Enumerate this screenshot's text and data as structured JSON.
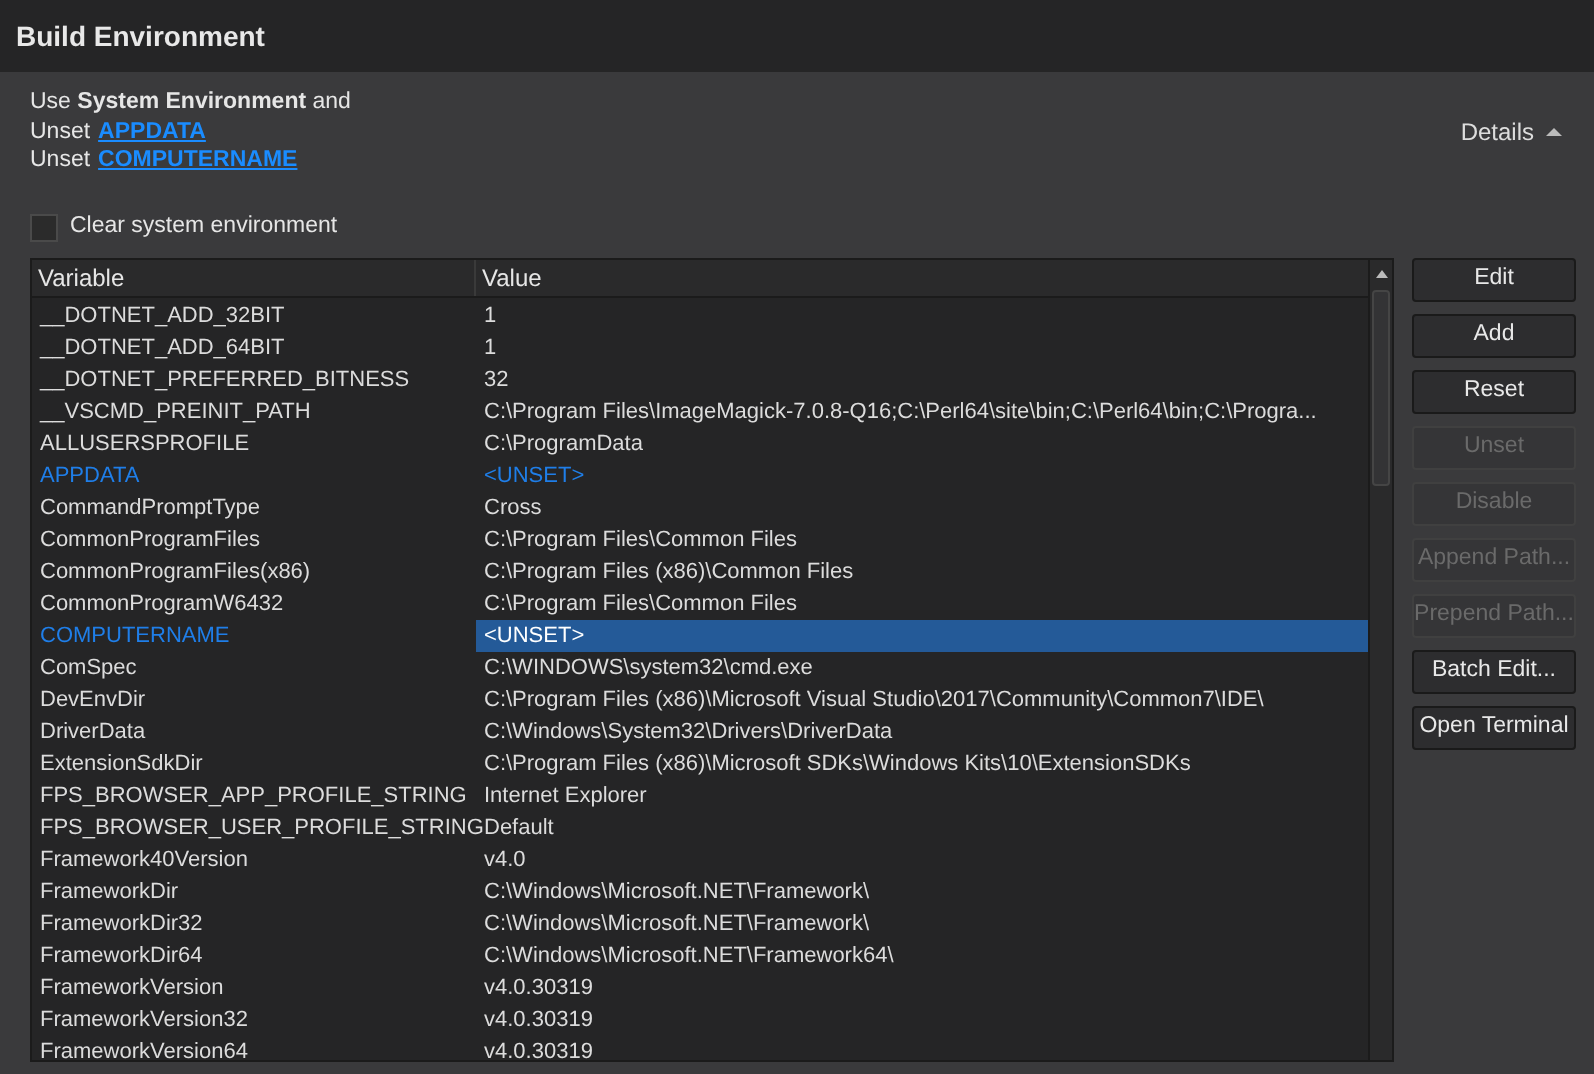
{
  "window": {
    "title": "Build Environment"
  },
  "summary": {
    "intro": "Use **System Environment** and",
    "lines": [
      {
        "prefix": "Unset",
        "link": "APPDATA"
      },
      {
        "prefix": "Unset",
        "link": "COMPUTERNAME"
      }
    ]
  },
  "details": {
    "label": "Details",
    "expanded": true
  },
  "clear_system_environment": {
    "label": "Clear system environment",
    "checked": false
  },
  "table": {
    "columns": [
      "Variable",
      "Value"
    ],
    "rows": [
      {
        "variable": "__DOTNET_ADD_32BIT",
        "value": "1",
        "unset": false,
        "selected": false
      },
      {
        "variable": "__DOTNET_ADD_64BIT",
        "value": "1",
        "unset": false,
        "selected": false
      },
      {
        "variable": "__DOTNET_PREFERRED_BITNESS",
        "value": "32",
        "unset": false,
        "selected": false
      },
      {
        "variable": "__VSCMD_PREINIT_PATH",
        "value": "C:\\Program Files\\ImageMagick-7.0.8-Q16;C:\\Perl64\\site\\bin;C:\\Perl64\\bin;C:\\Progra...",
        "unset": false,
        "selected": false
      },
      {
        "variable": "ALLUSERSPROFILE",
        "value": "C:\\ProgramData",
        "unset": false,
        "selected": false
      },
      {
        "variable": "APPDATA",
        "value": "<UNSET>",
        "unset": true,
        "selected": false
      },
      {
        "variable": "CommandPromptType",
        "value": "Cross",
        "unset": false,
        "selected": false
      },
      {
        "variable": "CommonProgramFiles",
        "value": "C:\\Program Files\\Common Files",
        "unset": false,
        "selected": false
      },
      {
        "variable": "CommonProgramFiles(x86)",
        "value": "C:\\Program Files (x86)\\Common Files",
        "unset": false,
        "selected": false
      },
      {
        "variable": "CommonProgramW6432",
        "value": "C:\\Program Files\\Common Files",
        "unset": false,
        "selected": false
      },
      {
        "variable": "COMPUTERNAME",
        "value": "<UNSET>",
        "unset": true,
        "selected": true
      },
      {
        "variable": "ComSpec",
        "value": "C:\\WINDOWS\\system32\\cmd.exe",
        "unset": false,
        "selected": false
      },
      {
        "variable": "DevEnvDir",
        "value": "C:\\Program Files (x86)\\Microsoft Visual Studio\\2017\\Community\\Common7\\IDE\\",
        "unset": false,
        "selected": false
      },
      {
        "variable": "DriverData",
        "value": "C:\\Windows\\System32\\Drivers\\DriverData",
        "unset": false,
        "selected": false
      },
      {
        "variable": "ExtensionSdkDir",
        "value": "C:\\Program Files (x86)\\Microsoft SDKs\\Windows Kits\\10\\ExtensionSDKs",
        "unset": false,
        "selected": false
      },
      {
        "variable": "FPS_BROWSER_APP_PROFILE_STRING",
        "value": "Internet Explorer",
        "unset": false,
        "selected": false
      },
      {
        "variable": "FPS_BROWSER_USER_PROFILE_STRING",
        "value": "Default",
        "unset": false,
        "selected": false
      },
      {
        "variable": "Framework40Version",
        "value": "v4.0",
        "unset": false,
        "selected": false
      },
      {
        "variable": "FrameworkDir",
        "value": "C:\\Windows\\Microsoft.NET\\Framework\\",
        "unset": false,
        "selected": false
      },
      {
        "variable": "FrameworkDir32",
        "value": "C:\\Windows\\Microsoft.NET\\Framework\\",
        "unset": false,
        "selected": false
      },
      {
        "variable": "FrameworkDir64",
        "value": "C:\\Windows\\Microsoft.NET\\Framework64\\",
        "unset": false,
        "selected": false
      },
      {
        "variable": "FrameworkVersion",
        "value": "v4.0.30319",
        "unset": false,
        "selected": false
      },
      {
        "variable": "FrameworkVersion32",
        "value": "v4.0.30319",
        "unset": false,
        "selected": false
      },
      {
        "variable": "FrameworkVersion64",
        "value": "v4.0.30319",
        "unset": false,
        "selected": false
      }
    ]
  },
  "buttons": [
    {
      "label": "Edit",
      "disabled": false
    },
    {
      "label": "Add",
      "disabled": false
    },
    {
      "label": "Reset",
      "disabled": false
    },
    {
      "label": "Unset",
      "disabled": true
    },
    {
      "label": "Disable",
      "disabled": true
    },
    {
      "label": "Append Path...",
      "disabled": true
    },
    {
      "label": "Prepend Path...",
      "disabled": true
    },
    {
      "label": "Batch Edit...",
      "disabled": false
    },
    {
      "label": "Open Terminal",
      "disabled": false
    }
  ]
}
